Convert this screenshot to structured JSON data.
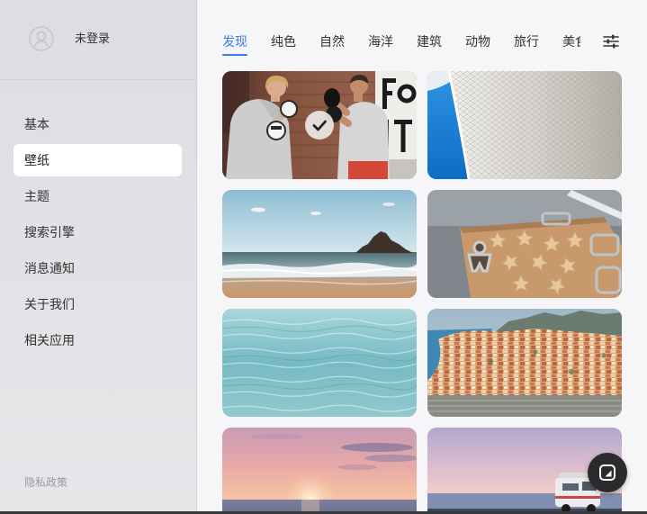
{
  "user": {
    "status_label": "未登录",
    "avatar_icon": "user-circle-icon"
  },
  "sidebar": {
    "items": [
      {
        "label": "基本",
        "active": false
      },
      {
        "label": "壁纸",
        "active": true
      },
      {
        "label": "主题",
        "active": false
      },
      {
        "label": "搜索引擎",
        "active": false
      },
      {
        "label": "消息通知",
        "active": false
      },
      {
        "label": "关于我们",
        "active": false
      },
      {
        "label": "相关应用",
        "active": false
      }
    ],
    "footer_link": "隐私政策"
  },
  "tabs": {
    "items": [
      {
        "label": "发现",
        "active": true
      },
      {
        "label": "纯色",
        "active": false
      },
      {
        "label": "自然",
        "active": false
      },
      {
        "label": "海洋",
        "active": false
      },
      {
        "label": "建筑",
        "active": false
      },
      {
        "label": "动物",
        "active": false
      },
      {
        "label": "旅行",
        "active": false
      },
      {
        "label": "美食",
        "active": false
      }
    ],
    "filter_icon": "sliders-icon"
  },
  "wallpapers": {
    "items": [
      {
        "selected": true
      },
      {
        "selected": false
      },
      {
        "selected": false
      },
      {
        "selected": false
      },
      {
        "selected": false
      },
      {
        "selected": false
      },
      {
        "selected": false
      },
      {
        "selected": false
      }
    ],
    "selected_icon": "check-icon"
  },
  "fab": {
    "icon": "image-icon"
  },
  "colors": {
    "accent": "#3a7de8",
    "sidebar_bg": "#e3e3e7",
    "main_bg": "#f6f6f8",
    "active_item_bg": "#ffffff",
    "fab_bg": "#2b2b2d",
    "text": "#333333",
    "muted_text": "#9b9b9f"
  }
}
